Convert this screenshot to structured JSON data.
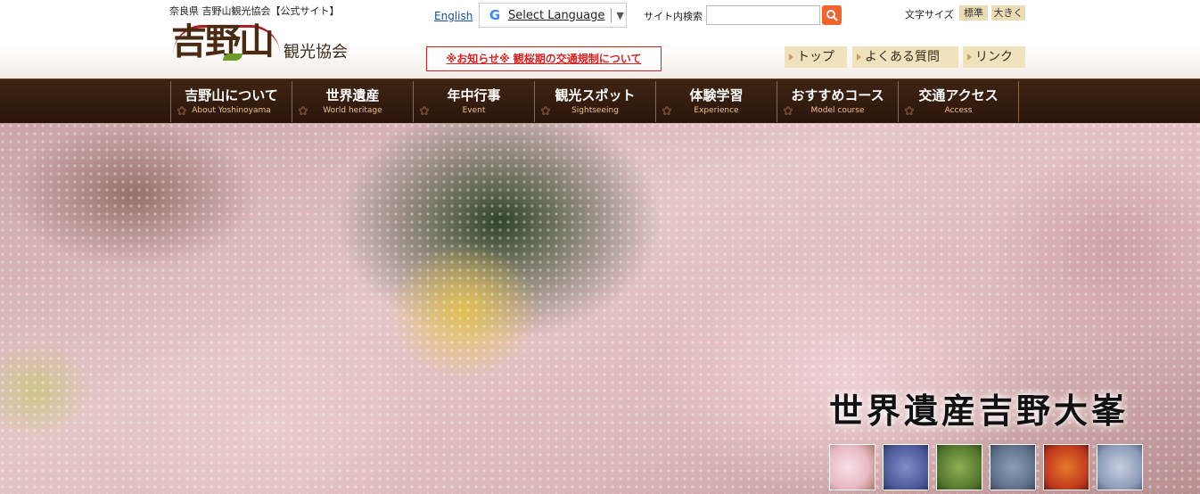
{
  "header": {
    "tagline": "奈良県 吉野山観光協会【公式サイト】",
    "logo_main": "吉野山",
    "logo_sub": "観光協会",
    "english_link": "English",
    "translate_label": "Select Language",
    "translate_arrow": "▼",
    "search_label": "サイト内検索",
    "search_placeholder": "",
    "font_size_label": "文字サイズ",
    "font_normal": "標準",
    "font_large": "大きく",
    "notice": "※お知らせ※ 観桜期の交通規制について",
    "util_links": [
      "トップ",
      "よくある質問",
      "リンク"
    ]
  },
  "nav": {
    "items": [
      {
        "jp": "吉野山について",
        "en": "About Yoshinoyama"
      },
      {
        "jp": "世界遺産",
        "en": "World heritage"
      },
      {
        "jp": "年中行事",
        "en": "Event"
      },
      {
        "jp": "観光スポット",
        "en": "Sightseeing"
      },
      {
        "jp": "体験学習",
        "en": "Experience"
      },
      {
        "jp": "おすすめコース",
        "en": "Model course"
      },
      {
        "jp": "交通アクセス",
        "en": "Access"
      }
    ]
  },
  "hero": {
    "caption": "世界遺産吉野大峯",
    "thumbnails": [
      "cherry-blossom",
      "hydrangea",
      "greenery",
      "winter-town",
      "autumn-leaves",
      "snow-temple"
    ]
  },
  "colors": {
    "nav_bg": "#3f2413",
    "accent_red": "#b11b22",
    "search_button": "#f2642a",
    "util_button": "#f0e2bd"
  }
}
